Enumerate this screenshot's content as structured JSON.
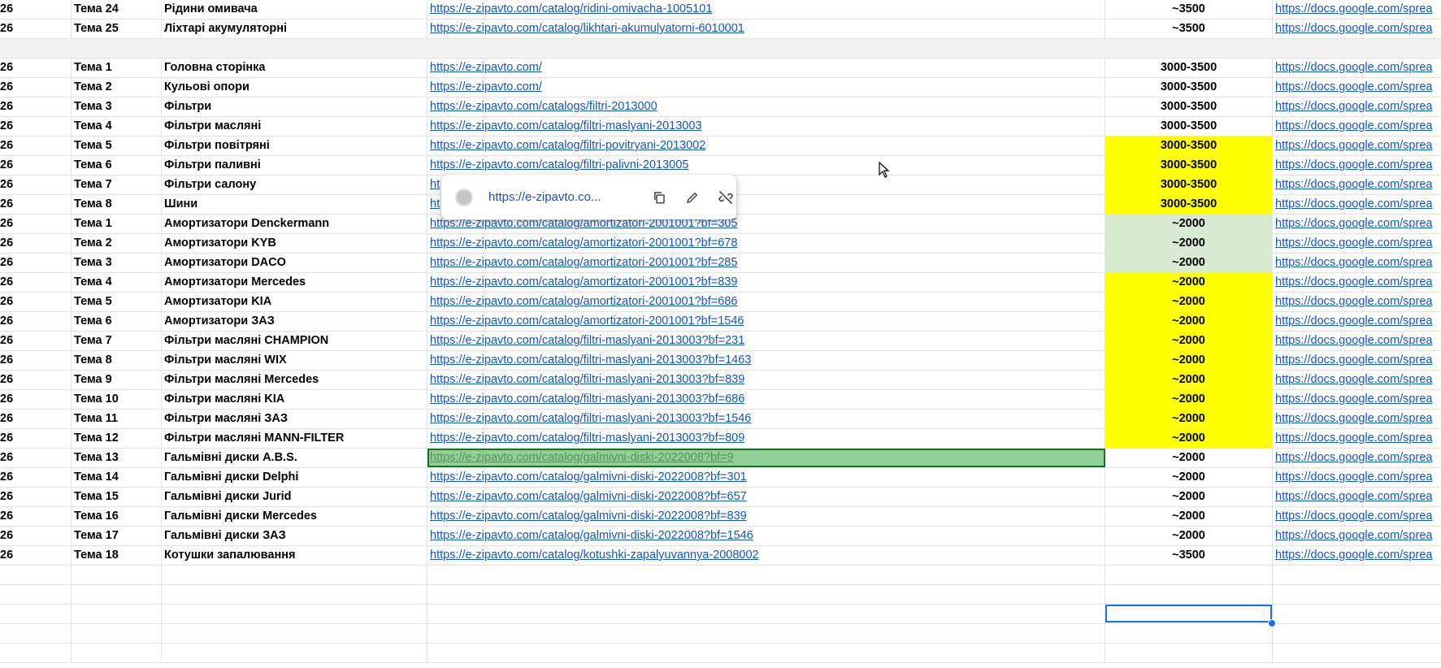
{
  "rows_top": [
    {
      "a": "26",
      "b": "Тема 24",
      "c": "Рідини омивача",
      "url": "https://e-zipavto.com/catalog/ridini-omivacha-1005101",
      "price": "~3500",
      "doc": "https://docs.google.com/sprea"
    },
    {
      "a": "26",
      "b": "Тема 25",
      "c": "Ліхтарі акумуляторні",
      "url": "https://e-zipavto.com/catalog/likhtari-akumulyatorni-6010001",
      "price": "~3500",
      "doc": "https://docs.google.com/sprea"
    }
  ],
  "rows": [
    {
      "a": "26",
      "b": "Тема 1",
      "c": "Головна сторінка",
      "url": "https://e-zipavto.com/",
      "price": "3000-3500",
      "doc": "https://docs.google.com/sprea",
      "hl": ""
    },
    {
      "a": "26",
      "b": "Тема 2",
      "c": "Кульові опори",
      "url": "https://e-zipavto.com/",
      "price": "3000-3500",
      "doc": "https://docs.google.com/sprea",
      "hl": ""
    },
    {
      "a": "26",
      "b": "Тема 3",
      "c": "Фільтри",
      "url": "https://e-zipavto.com/catalogs/filtri-2013000",
      "price": "3000-3500",
      "doc": "https://docs.google.com/sprea",
      "hl": ""
    },
    {
      "a": "26",
      "b": "Тема 4",
      "c": "Фільтри масляні",
      "url": "https://e-zipavto.com/catalog/filtri-maslyani-2013003",
      "price": "3000-3500",
      "doc": "https://docs.google.com/sprea",
      "hl": ""
    },
    {
      "a": "26",
      "b": "Тема 5",
      "c": "Фільтри повітряні",
      "url": "https://e-zipavto.com/catalog/filtri-povitryani-2013002",
      "price": "3000-3500",
      "doc": "https://docs.google.com/sprea",
      "hl": "yellow"
    },
    {
      "a": "26",
      "b": "Тема 6",
      "c": "Фільтри паливні",
      "url": "https://e-zipavto.com/catalog/filtri-palivni-2013005",
      "price": "3000-3500",
      "doc": "https://docs.google.com/sprea",
      "hl": "yellow"
    },
    {
      "a": "26",
      "b": "Тема 7",
      "c": "Фільтри салону",
      "url": "ht",
      "price": "3000-3500",
      "doc": "https://docs.google.com/sprea",
      "hl": "yellow"
    },
    {
      "a": "26",
      "b": "Тема 8",
      "c": "Шини",
      "url": "ht",
      "price": "3000-3500",
      "doc": "https://docs.google.com/sprea",
      "hl": "yellow"
    },
    {
      "a": "26",
      "b": "Тема 1",
      "c": "Амортизатори Denckermann",
      "url": "https://e-zipavto.com/catalog/amortizatori-2001001?bf=305",
      "price": "~2000",
      "doc": "https://docs.google.com/sprea",
      "hl": "green"
    },
    {
      "a": "26",
      "b": "Тема 2",
      "c": "Амортизатори KYB",
      "url": "https://e-zipavto.com/catalog/amortizatori-2001001?bf=678",
      "price": "~2000",
      "doc": "https://docs.google.com/sprea",
      "hl": "green"
    },
    {
      "a": "26",
      "b": "Тема 3",
      "c": "Амортизатори DACO",
      "url": "https://e-zipavto.com/catalog/amortizatori-2001001?bf=285",
      "price": "~2000",
      "doc": "https://docs.google.com/sprea",
      "hl": "green"
    },
    {
      "a": "26",
      "b": "Тема 4",
      "c": "Амортизатори Mercedes",
      "url": "https://e-zipavto.com/catalog/amortizatori-2001001?bf=839",
      "price": "~2000",
      "doc": "https://docs.google.com/sprea",
      "hl": "yellow"
    },
    {
      "a": "26",
      "b": "Тема 5",
      "c": "Амортизатори KIA",
      "url": "https://e-zipavto.com/catalog/amortizatori-2001001?bf=686",
      "price": "~2000",
      "doc": "https://docs.google.com/sprea",
      "hl": "yellow"
    },
    {
      "a": "26",
      "b": "Тема 6",
      "c": "Амортизатори ЗАЗ",
      "url": "https://e-zipavto.com/catalog/amortizatori-2001001?bf=1546",
      "price": "~2000",
      "doc": "https://docs.google.com/sprea",
      "hl": "yellow"
    },
    {
      "a": "26",
      "b": "Тема 7",
      "c": "Фільтри масляні CHAMPION",
      "url": "https://e-zipavto.com/catalog/filtri-maslyani-2013003?bf=231",
      "price": "~2000",
      "doc": "https://docs.google.com/sprea",
      "hl": "yellow"
    },
    {
      "a": "26",
      "b": "Тема 8",
      "c": "Фільтри масляні WIX",
      "url": "https://e-zipavto.com/catalog/filtri-maslyani-2013003?bf=1463",
      "price": "~2000",
      "doc": "https://docs.google.com/sprea",
      "hl": "yellow"
    },
    {
      "a": "26",
      "b": "Тема 9",
      "c": "Фільтри масляні Mercedes",
      "url": "https://e-zipavto.com/catalog/filtri-maslyani-2013003?bf=839",
      "price": "~2000",
      "doc": "https://docs.google.com/sprea",
      "hl": "yellow"
    },
    {
      "a": "26",
      "b": "Тема 10",
      "c": "Фільтри масляні KIA",
      "url": "https://e-zipavto.com/catalog/filtri-maslyani-2013003?bf=686",
      "price": "~2000",
      "doc": "https://docs.google.com/sprea",
      "hl": "yellow"
    },
    {
      "a": "26",
      "b": "Тема 11",
      "c": "Фільтри масляні ЗАЗ",
      "url": "https://e-zipavto.com/catalog/filtri-maslyani-2013003?bf=1546",
      "price": "~2000",
      "doc": "https://docs.google.com/sprea",
      "hl": "yellow"
    },
    {
      "a": "26",
      "b": "Тема 12",
      "c": "Фільтри масляні MANN-FILTER",
      "url": "https://e-zipavto.com/catalog/filtri-maslyani-2013003?bf=809",
      "price": "~2000",
      "doc": "https://docs.google.com/sprea",
      "hl": "yellow"
    },
    {
      "a": "26",
      "b": "Тема 13",
      "c": "Гальмівні диски A.B.S.",
      "url": "https://e-zipavto.com/catalog/galmivni-diski-2022008?bf=9",
      "price": "~2000",
      "doc": "https://docs.google.com/sprea",
      "hl": "",
      "selected": true
    },
    {
      "a": "26",
      "b": "Тема 14",
      "c": "Гальмівні диски Delphi",
      "url": "https://e-zipavto.com/catalog/galmivni-diski-2022008?bf=301",
      "price": "~2000",
      "doc": "https://docs.google.com/sprea",
      "hl": ""
    },
    {
      "a": "26",
      "b": "Тема 15",
      "c": "Гальмівні диски Jurid",
      "url": "https://e-zipavto.com/catalog/galmivni-diski-2022008?bf=657",
      "price": "~2000",
      "doc": "https://docs.google.com/sprea",
      "hl": ""
    },
    {
      "a": "26",
      "b": "Тема 16",
      "c": "Гальмівні диски Mercedes",
      "url": "https://e-zipavto.com/catalog/galmivni-diski-2022008?bf=839",
      "price": "~2000",
      "doc": "https://docs.google.com/sprea",
      "hl": ""
    },
    {
      "a": "26",
      "b": "Тема 17",
      "c": "Гальмівні диски ЗАЗ",
      "url": "https://e-zipavto.com/catalog/galmivni-diski-2022008?bf=1546",
      "price": "~2000",
      "doc": "https://docs.google.com/sprea",
      "hl": ""
    },
    {
      "a": "26",
      "b": "Тема 18",
      "c": "Котушки запалювання",
      "url": "https://e-zipavto.com/catalog/kotushki-zapalyuvannya-2008002",
      "price": "~3500",
      "doc": "https://docs.google.com/sprea",
      "hl": ""
    }
  ],
  "empty_rows": 5,
  "link_popup": {
    "url_display": "https://e-zipavto.co...",
    "favicon": "globe-favicon",
    "copy_icon": "copy-icon",
    "edit_icon": "pencil-icon",
    "unlink_icon": "unlink-icon"
  },
  "colors": {
    "yellow": "#ffff00",
    "green": "#d9ead3",
    "selected": "#93d096",
    "link": "#1155cc",
    "active": "#1a73e8"
  }
}
